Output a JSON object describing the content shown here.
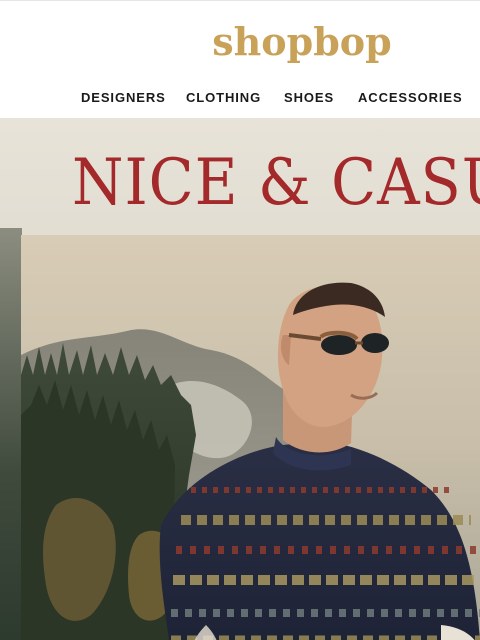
{
  "header": {
    "logo_text": "shopbop",
    "nav": [
      {
        "label": "DESIGNERS"
      },
      {
        "label": "CLOTHING"
      },
      {
        "label": "SHOES"
      },
      {
        "label": "ACCESSORIES"
      }
    ]
  },
  "hero": {
    "headline": "NICE & CASUAL"
  },
  "colors": {
    "logo_gold": "#c9a25a",
    "headline_red": "#a3292a",
    "nav_text": "#1a1a1a"
  }
}
